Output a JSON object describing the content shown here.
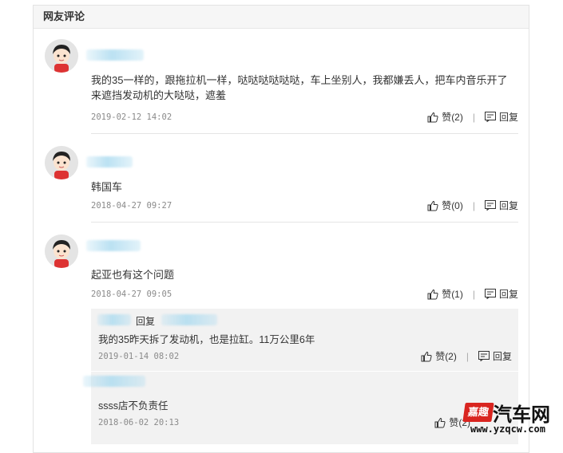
{
  "section": {
    "title": "网友评论"
  },
  "comments": [
    {
      "text_line1": "我的35一样的，跟拖拉机一样，哒哒哒哒哒哒，车上坐别人，我都嫌丢人，把车内音乐开了",
      "text_line2": "来遮挡发动机的大哒哒，遮羞",
      "time": "2019-02-12 14:02",
      "like_label": "赞(2)",
      "reply_label": "回复"
    },
    {
      "text_line1": "韩国车",
      "time": "2018-04-27 09:27",
      "like_label": "赞(0)",
      "reply_label": "回复"
    },
    {
      "text_line1": "起亚也有这个问题",
      "time": "2018-04-27 09:05",
      "like_label": "赞(1)",
      "reply_label": "回复"
    }
  ],
  "replies": [
    {
      "reply_word": "回复",
      "text": "我的35昨天拆了发动机，也是拉缸。11万公里6年",
      "time": "2019-01-14 08:02",
      "like_label": "赞(2)",
      "reply_label": "回复"
    },
    {
      "text": "ssss店不负责任",
      "time": "2018-06-02 20:13",
      "like_label": "赞(2)"
    }
  ],
  "watermark": {
    "logo_text": "嘉趣",
    "site_name": "汽车网",
    "url": "www.yzqcw.com"
  },
  "colors": {
    "accent_red": "#d92520",
    "reply_bg": "#f2f2f2"
  }
}
